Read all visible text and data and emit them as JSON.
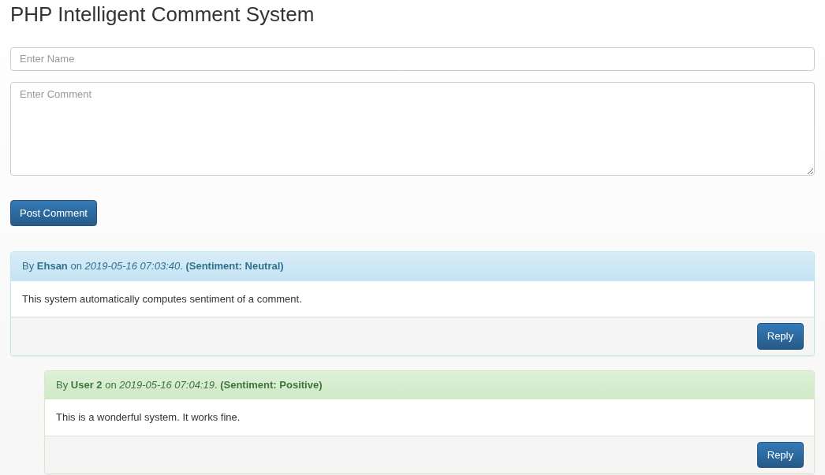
{
  "title": "PHP Intelligent Comment System",
  "form": {
    "name_placeholder": "Enter Name",
    "comment_placeholder": "Enter Comment",
    "submit": "Post Comment"
  },
  "comments": [
    {
      "kind": "neutral",
      "header": "By **Ehsan** on *2019-05-16 07:03:40*. **(Sentiment: Neutral)**",
      "body": "This system automatically computes sentiment of a comment.",
      "reply": "Reply",
      "children": [
        {
          "kind": "positive",
          "header": "By **User 2** on *2019-05-16 07:04:19*. **(Sentiment: Positive)**",
          "body": "This is a wonderful system. It works fine.",
          "reply": "Reply"
        }
      ]
    }
  ]
}
